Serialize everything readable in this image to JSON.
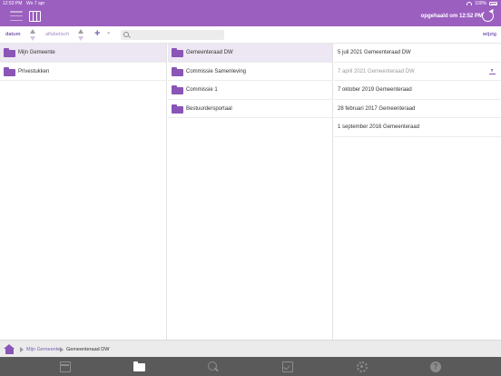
{
  "status_bar": {
    "time": "12:53 PM",
    "date": "Wo 7 apr",
    "battery": "100%"
  },
  "header": {
    "fetched_label": "opgehaald om 12:52 PM",
    "icons": [
      "menu-icon",
      "columns-icon",
      "refresh-icon"
    ]
  },
  "toolbar": {
    "sort_date": "datum",
    "sort_alpha": "alfabetisch",
    "add": "+",
    "remove": "-",
    "search_placeholder": "",
    "edit": "wijzig"
  },
  "columns": {
    "col1": [
      {
        "label": "Mijn Gemeente",
        "selected": true
      },
      {
        "label": "Privestukken",
        "selected": false
      }
    ],
    "col2": [
      {
        "label": "Gemeenteraad DW",
        "selected": true
      },
      {
        "label": "Commissie Samenleving",
        "selected": false
      },
      {
        "label": "Commissie 1",
        "selected": false
      },
      {
        "label": "Bestuurdersportaal",
        "selected": false
      }
    ],
    "col3": [
      {
        "label": "5 juli 2021 Gemeenteraad DW",
        "dim": false
      },
      {
        "label": "7 april 2021 Gemeenteraad DW",
        "dim": true,
        "download": true
      },
      {
        "label": "7 oktober 2019 Gemeenteraad",
        "dim": false
      },
      {
        "label": "28 februari 2017 Gemeenteraad",
        "dim": false
      },
      {
        "label": "1 september 2016 Gemeenteraad",
        "dim": false
      }
    ]
  },
  "breadcrumb": {
    "items": [
      "Mijn Gemeente",
      "Gemeenteraad DW"
    ]
  },
  "tabbar": {
    "tabs": [
      "calendar-icon",
      "documents-icon",
      "search-icon",
      "tasks-icon",
      "settings-icon",
      "help-icon"
    ],
    "help_glyph": "?"
  },
  "colors": {
    "accent": "#9b5fc0",
    "folder": "#8a55b6",
    "tabbar": "#5a5a5a"
  }
}
